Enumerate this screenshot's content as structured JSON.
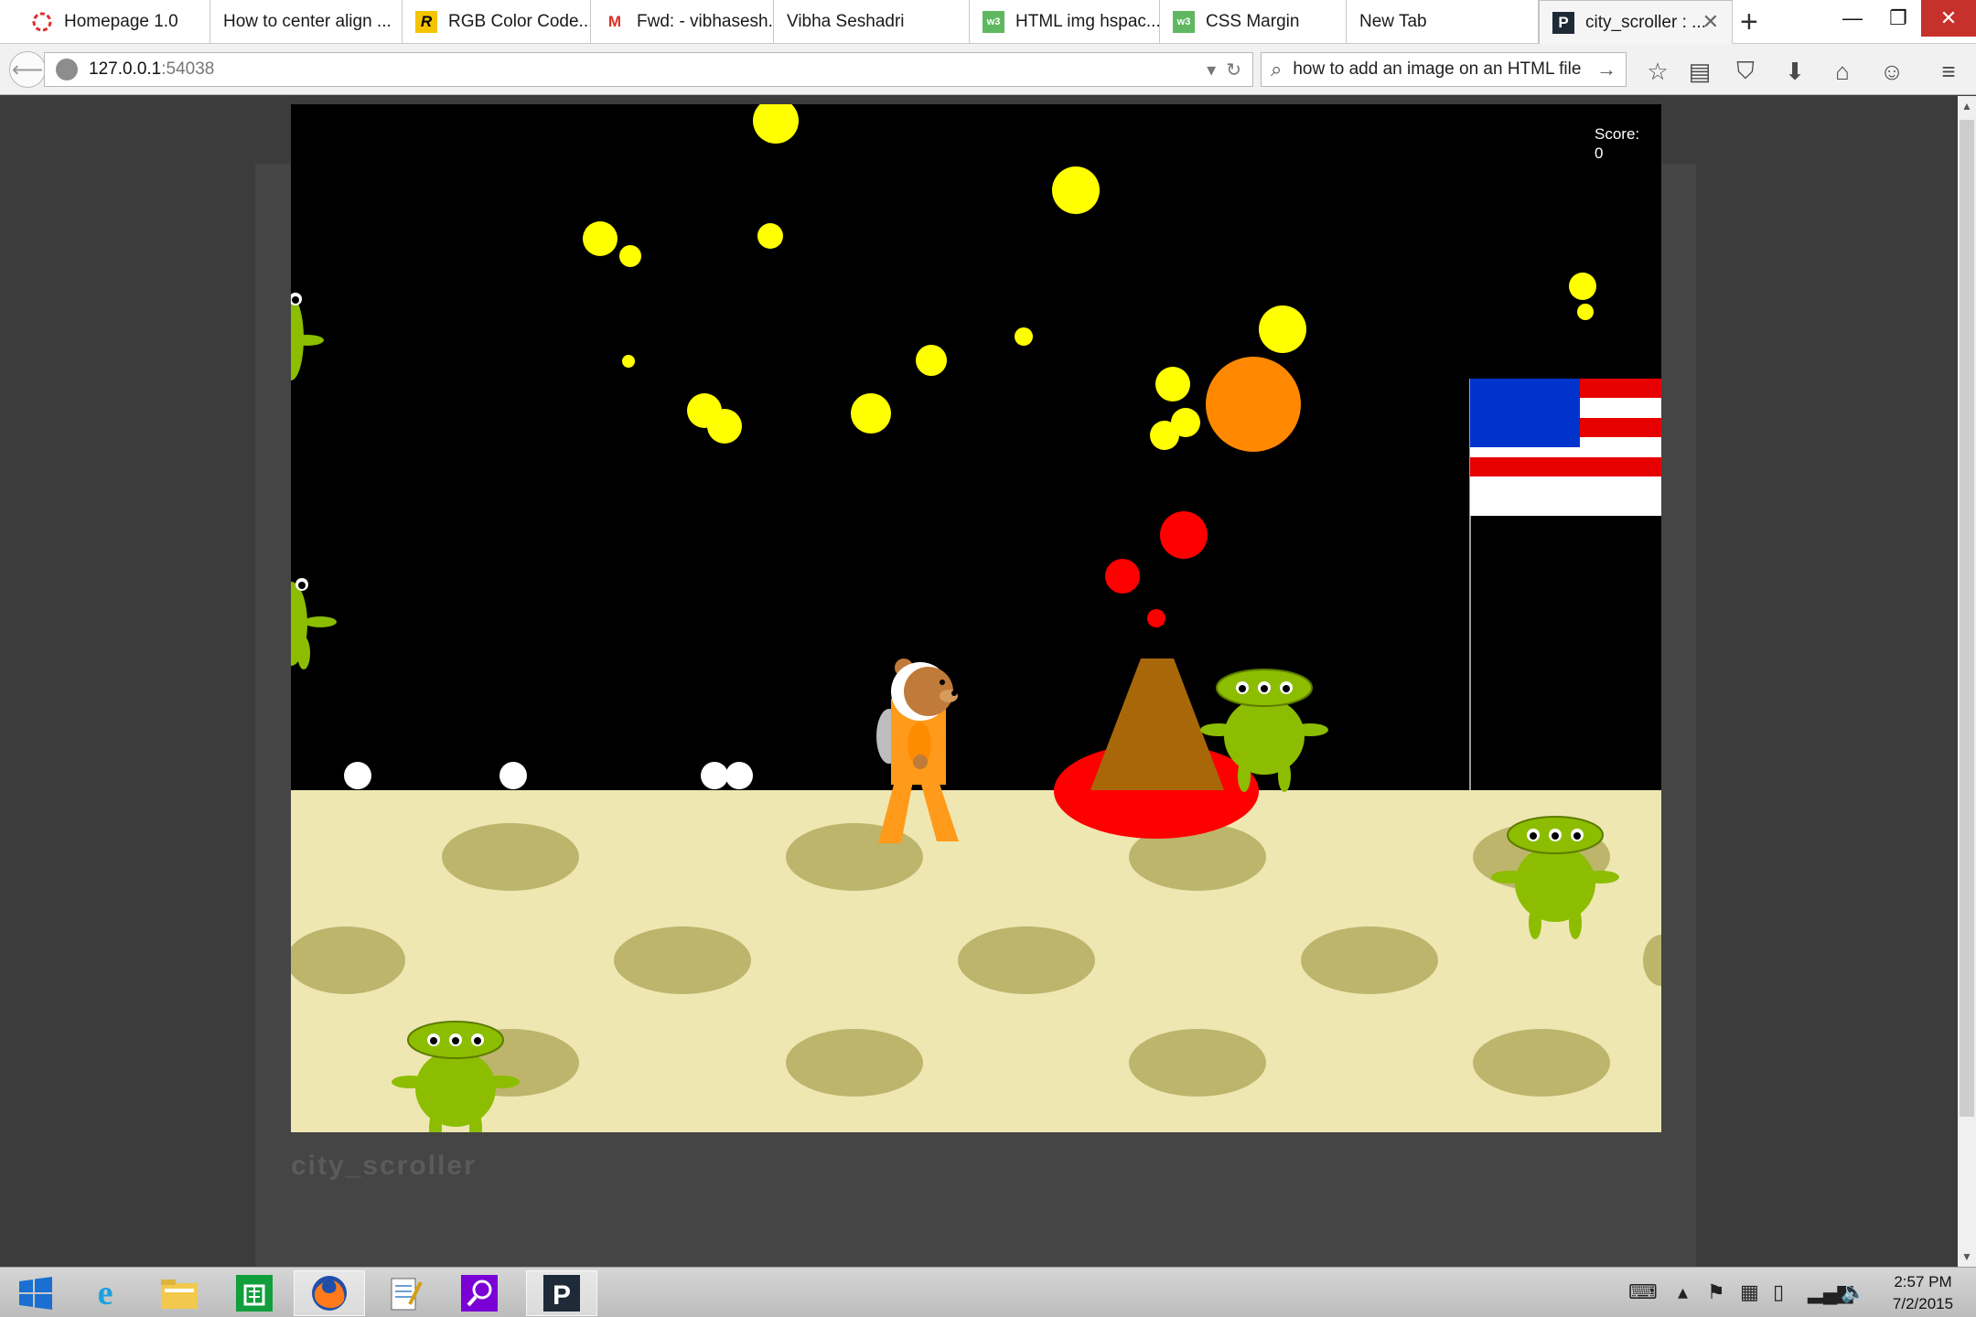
{
  "tabs": [
    {
      "title": "Homepage 1.0",
      "icon": "homepage-icon"
    },
    {
      "title": "How to center align ...",
      "icon": "blank-icon"
    },
    {
      "title": "RGB Color Code...",
      "icon": "rgb-r-icon"
    },
    {
      "title": "Fwd: - vibhasesh...",
      "icon": "gmail-icon"
    },
    {
      "title": "Vibha Seshadri",
      "icon": "blank-icon"
    },
    {
      "title": "HTML img hspac...",
      "icon": "w3-icon"
    },
    {
      "title": "CSS Margin",
      "icon": "w3-icon"
    },
    {
      "title": "New Tab",
      "icon": "blank-icon"
    },
    {
      "title": "city_scroller : ...",
      "icon": "p-icon",
      "active": true
    }
  ],
  "navbar": {
    "url_host": "127.0.0.1",
    "url_port": ":54038",
    "search_text": "how to add an image on an HTML file"
  },
  "icons": {
    "toolbar": [
      "bookmark-star-icon",
      "reading-list-icon",
      "pocket-icon",
      "download-icon",
      "home-icon",
      "hello-icon",
      "menu-icon"
    ],
    "taskbar": [
      "windows-start-icon",
      "internet-explorer-icon",
      "file-explorer-icon",
      "store-icon",
      "firefox-icon",
      "notepad-icon",
      "search-app-icon",
      "processing-p-icon"
    ],
    "tray": [
      "keyboard-icon",
      "show-hidden-icon",
      "flag-icon",
      "windows-icon",
      "battery-icon",
      "signal-icon",
      "volume-icon"
    ]
  },
  "game": {
    "score_label": "Score:",
    "score_value": "0",
    "title": "city_scroller"
  },
  "colors": {
    "sky": "#000000",
    "ground": "#efe7b2",
    "crater": "#bdb56c",
    "alien": "#8cbd00",
    "star": "#ffff00",
    "sun": "#ff8800",
    "lava": "#ff0000",
    "volcano": "#a8680a",
    "bear": "#c07a3a",
    "suit": "#ff9a1a",
    "flag_blue": "#0033cc",
    "flag_red": "#e60000"
  },
  "clock": {
    "time": "2:57 PM",
    "date": "7/2/2015"
  }
}
